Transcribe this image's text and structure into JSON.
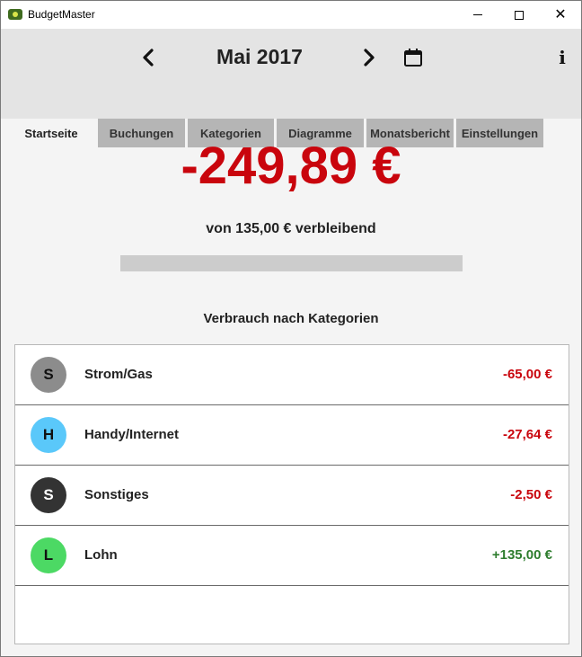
{
  "window": {
    "title": "BudgetMaster",
    "controls": {
      "minimize_icon": "minimize-icon",
      "maximize_icon": "maximize-icon",
      "close_icon": "close-icon"
    }
  },
  "header": {
    "month": "Mai 2017",
    "prev_icon": "chevron-left-icon",
    "next_icon": "chevron-right-icon",
    "calendar_icon": "calendar-icon",
    "info_label": "i"
  },
  "tabs": [
    {
      "label": "Startseite",
      "active": true
    },
    {
      "label": "Buchungen",
      "active": false
    },
    {
      "label": "Kategorien",
      "active": false
    },
    {
      "label": "Diagramme",
      "active": false
    },
    {
      "label": "Monatsbericht",
      "active": false
    },
    {
      "label": "Einstellungen",
      "active": false
    }
  ],
  "summary": {
    "amount": "-249,89 €",
    "amount_color": "#c9050d",
    "remaining_text": "von 135,00 € verbleibend",
    "progress_fraction": 0
  },
  "categories_section": {
    "title": "Verbrauch nach Kategorien",
    "items": [
      {
        "initial": "S",
        "name": "Strom/Gas",
        "amount": "-65,00 €",
        "color": "#8c8c8c",
        "text_color": "#111111",
        "amount_color": "#c9050d"
      },
      {
        "initial": "H",
        "name": "Handy/Internet",
        "amount": "-27,64 €",
        "color": "#5ac8fa",
        "text_color": "#111111",
        "amount_color": "#c9050d"
      },
      {
        "initial": "S",
        "name": "Sonstiges",
        "amount": "-2,50 €",
        "color": "#333333",
        "text_color": "#ffffff",
        "amount_color": "#c9050d"
      },
      {
        "initial": "L",
        "name": "Lohn",
        "amount": "+135,00 €",
        "color": "#4cd964",
        "text_color": "#111111",
        "amount_color": "#2e7d2e"
      }
    ]
  }
}
